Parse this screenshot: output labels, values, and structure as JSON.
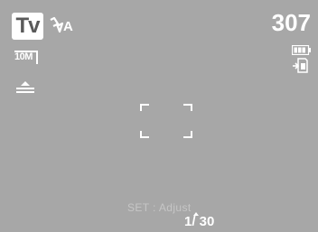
{
  "screen": {
    "background_color": "#a7a7a7",
    "overlay_color": "#ffffff"
  },
  "mode": {
    "label": "Tv",
    "icon": "shutter-priority-mode-icon"
  },
  "flash": {
    "label": "A",
    "icon": "flash-auto-icon"
  },
  "shots_remaining": "307",
  "battery": {
    "icon": "battery-full-icon"
  },
  "storage": {
    "icon": "internal-memory-icon"
  },
  "resolution": {
    "label": "10M",
    "icon": "image-size-icon"
  },
  "quality": {
    "icon": "image-quality-icon"
  },
  "focus_frame": {
    "icon": "af-frame-icon"
  },
  "hint": {
    "text": "SET : Adjust"
  },
  "shutter_speed": {
    "value": "1/ 30"
  }
}
